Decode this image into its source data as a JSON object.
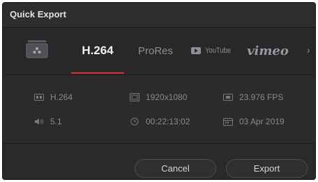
{
  "window": {
    "title": "Quick Export"
  },
  "tabs": {
    "preset_icon": "render-preset-icon",
    "items": [
      {
        "label": "H.264",
        "selected": true
      },
      {
        "label": "ProRes",
        "selected": false
      },
      {
        "label": "YouTube",
        "selected": false
      },
      {
        "label": "vimeo",
        "selected": false
      }
    ],
    "more_icon": "chevron-right-icon",
    "more_glyph": "›",
    "accent_color": "#d9312f"
  },
  "info": {
    "codec": {
      "icon": "codec-icon",
      "value": "H.264"
    },
    "audio": {
      "icon": "speaker-icon",
      "value": "5.1"
    },
    "resolution": {
      "icon": "resolution-icon",
      "value": "1920x1080"
    },
    "duration": {
      "icon": "clock-icon",
      "value": "00:22:13:02"
    },
    "framerate": {
      "icon": "film-icon",
      "value": "23.976 FPS"
    },
    "date": {
      "icon": "calendar-icon",
      "value": "03 Apr 2019"
    }
  },
  "buttons": {
    "cancel": "Cancel",
    "export": "Export"
  }
}
